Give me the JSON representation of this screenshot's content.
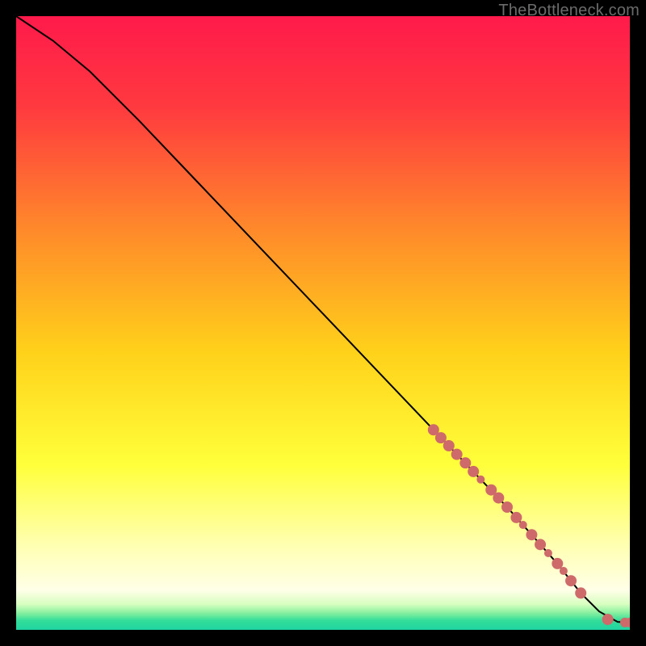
{
  "watermark": "TheBottleneck.com",
  "chart_data": {
    "type": "line",
    "title": "",
    "xlabel": "",
    "ylabel": "",
    "xlim": [
      0,
      100
    ],
    "ylim": [
      0,
      100
    ],
    "background_gradient": {
      "stops": [
        {
          "offset": 0.0,
          "color": "#ff1a4b"
        },
        {
          "offset": 0.15,
          "color": "#ff3a3f"
        },
        {
          "offset": 0.35,
          "color": "#ff8a2a"
        },
        {
          "offset": 0.55,
          "color": "#ffd21a"
        },
        {
          "offset": 0.73,
          "color": "#ffff3a"
        },
        {
          "offset": 0.86,
          "color": "#ffffb0"
        },
        {
          "offset": 0.935,
          "color": "#ffffe8"
        },
        {
          "offset": 0.958,
          "color": "#d8ffc0"
        },
        {
          "offset": 0.972,
          "color": "#8af0a0"
        },
        {
          "offset": 0.985,
          "color": "#33dd99"
        },
        {
          "offset": 1.0,
          "color": "#1fd3a0"
        }
      ]
    },
    "series": [
      {
        "name": "bottleneck-curve",
        "type": "line",
        "color": "#000000",
        "x": [
          0,
          6,
          12,
          20,
          30,
          40,
          50,
          60,
          70,
          80,
          88,
          92,
          95,
          98,
          100
        ],
        "y": [
          100,
          96,
          91,
          83,
          72.5,
          62,
          51.5,
          41,
          30.5,
          20,
          11,
          6,
          3,
          1.3,
          1.2
        ]
      }
    ],
    "scatter": {
      "name": "highlight-points",
      "color": "#cf6a6a",
      "radius_primary": 7,
      "radius_secondary": 5,
      "points": [
        {
          "x": 68.0,
          "y": 32.6,
          "r": 7
        },
        {
          "x": 69.2,
          "y": 31.3,
          "r": 7
        },
        {
          "x": 70.5,
          "y": 30.0,
          "r": 7
        },
        {
          "x": 71.8,
          "y": 28.6,
          "r": 7
        },
        {
          "x": 73.2,
          "y": 27.2,
          "r": 7
        },
        {
          "x": 74.5,
          "y": 25.8,
          "r": 7
        },
        {
          "x": 75.7,
          "y": 24.5,
          "r": 5
        },
        {
          "x": 77.4,
          "y": 22.8,
          "r": 7
        },
        {
          "x": 78.6,
          "y": 21.5,
          "r": 7
        },
        {
          "x": 80.0,
          "y": 20.0,
          "r": 7
        },
        {
          "x": 81.5,
          "y": 18.3,
          "r": 7
        },
        {
          "x": 82.6,
          "y": 17.1,
          "r": 5
        },
        {
          "x": 84.0,
          "y": 15.5,
          "r": 7
        },
        {
          "x": 85.4,
          "y": 13.9,
          "r": 7
        },
        {
          "x": 86.7,
          "y": 12.5,
          "r": 5
        },
        {
          "x": 88.2,
          "y": 10.8,
          "r": 7
        },
        {
          "x": 89.2,
          "y": 9.6,
          "r": 5
        },
        {
          "x": 90.4,
          "y": 8.0,
          "r": 7
        },
        {
          "x": 92.0,
          "y": 6.0,
          "r": 7
        },
        {
          "x": 96.4,
          "y": 1.7,
          "r": 7
        },
        {
          "x": 99.2,
          "y": 1.2,
          "r": 6
        },
        {
          "x": 100.0,
          "y": 1.2,
          "r": 6
        }
      ]
    }
  }
}
